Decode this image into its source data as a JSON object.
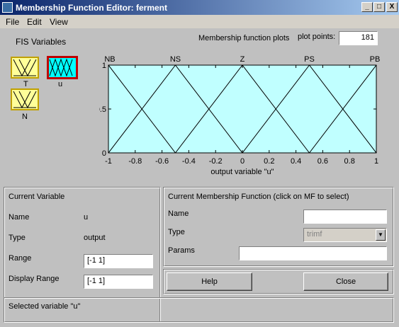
{
  "window": {
    "title": "Membership Function Editor: ferment",
    "buttons": {
      "minimize": "_",
      "maximize": "□",
      "close": "X"
    }
  },
  "menu": [
    "File",
    "Edit",
    "View"
  ],
  "fis_variables": {
    "heading": "FIS Variables",
    "items": [
      {
        "label": "T",
        "selected": false
      },
      {
        "label": "u",
        "selected": true
      },
      {
        "label": "N",
        "selected": false
      }
    ]
  },
  "plot_header": {
    "title": "Membership function plots",
    "plot_points_label": "plot points:",
    "plot_points_value": "181"
  },
  "chart_data": {
    "type": "line",
    "xlabel": "output variable \"u\"",
    "xlim": [
      -1,
      1
    ],
    "ylim": [
      0,
      1
    ],
    "x_ticks": [
      "-1",
      "-0.8",
      "-0.6",
      "-0.4",
      "-0.2",
      "0",
      "0.2",
      "0.4",
      "0.6",
      "0.8",
      "1"
    ],
    "y_ticks": [
      "0",
      "0.5",
      "1"
    ],
    "series": [
      {
        "name": "NB",
        "x": [
          -1.5,
          -1,
          -0.5
        ],
        "y": [
          0,
          1,
          0
        ]
      },
      {
        "name": "NS",
        "x": [
          -1,
          -0.5,
          0
        ],
        "y": [
          0,
          1,
          0
        ]
      },
      {
        "name": "Z",
        "x": [
          -0.5,
          0,
          0.5
        ],
        "y": [
          0,
          1,
          0
        ]
      },
      {
        "name": "PS",
        "x": [
          0,
          0.5,
          1
        ],
        "y": [
          0,
          1,
          0
        ]
      },
      {
        "name": "PB",
        "x": [
          0.5,
          1,
          1.5
        ],
        "y": [
          0,
          1,
          0
        ]
      }
    ],
    "colors": {
      "background": "#c0ffff",
      "line": "#000000"
    }
  },
  "current_variable": {
    "heading": "Current Variable",
    "name_label": "Name",
    "name_value": "u",
    "type_label": "Type",
    "type_value": "output",
    "range_label": "Range",
    "range_value": "[-1 1]",
    "display_range_label": "Display Range",
    "display_range_value": "[-1 1]"
  },
  "current_mf": {
    "heading": "Current Membership Function (click on MF to select)",
    "name_label": "Name",
    "name_value": "",
    "type_label": "Type",
    "type_value": "trimf",
    "params_label": "Params",
    "params_value": ""
  },
  "buttons": {
    "help": "Help",
    "close": "Close"
  },
  "status": "Selected variable \"u\""
}
